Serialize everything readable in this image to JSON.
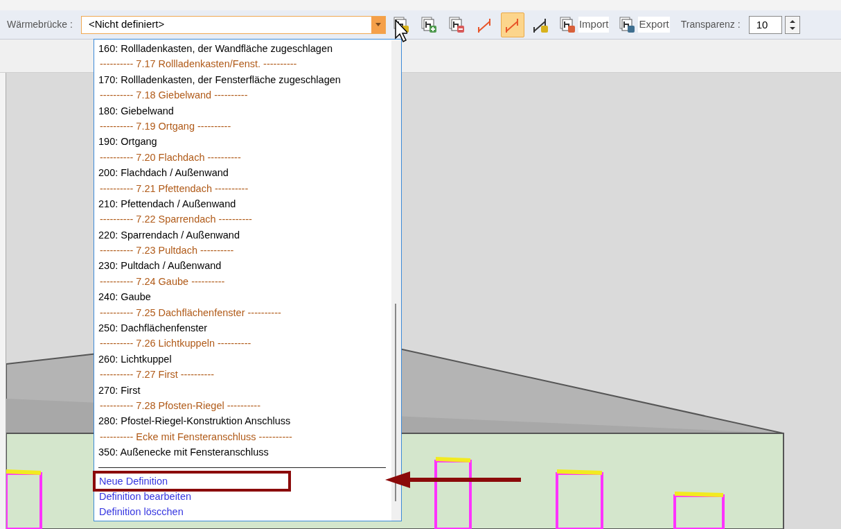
{
  "toolbar": {
    "label": "Wärmebrücke :",
    "combo_value": "<Nicht definiert>",
    "buttons": [
      {
        "kind": "edit",
        "selected": false
      },
      {
        "kind": "add",
        "selected": false
      },
      {
        "kind": "remove",
        "selected": false
      },
      {
        "kind": "line",
        "selected": false
      },
      {
        "kind": "line-active",
        "selected": true
      },
      {
        "kind": "line-edit",
        "selected": false
      },
      {
        "kind": "import",
        "label": "Import",
        "selected": false
      },
      {
        "kind": "export",
        "label": "Export",
        "selected": false
      }
    ],
    "transparency_label": "Transparenz :",
    "transparency_value": "10"
  },
  "dropdown": {
    "items": [
      {
        "kind": "entry",
        "text": "160: Rollladenkasten, der Wandfläche zugeschlagen"
      },
      {
        "kind": "header",
        "text": "---------- 7.17 Rollladenkasten/Fenst. ----------"
      },
      {
        "kind": "entry",
        "text": "170: Rollladenkasten, der Fensterfläche zugeschlagen"
      },
      {
        "kind": "header",
        "text": "---------- 7.18 Giebelwand ----------"
      },
      {
        "kind": "entry",
        "text": "180: Giebelwand"
      },
      {
        "kind": "header",
        "text": "---------- 7.19 Ortgang ----------"
      },
      {
        "kind": "entry",
        "text": "190: Ortgang"
      },
      {
        "kind": "header",
        "text": "---------- 7.20 Flachdach ----------"
      },
      {
        "kind": "entry",
        "text": "200: Flachdach / Außenwand"
      },
      {
        "kind": "header",
        "text": "---------- 7.21 Pfettendach ----------"
      },
      {
        "kind": "entry",
        "text": "210: Pfettendach / Außenwand"
      },
      {
        "kind": "header",
        "text": "---------- 7.22 Sparrendach ----------"
      },
      {
        "kind": "entry",
        "text": "220: Sparrendach / Außenwand"
      },
      {
        "kind": "header",
        "text": "---------- 7.23 Pultdach ----------"
      },
      {
        "kind": "entry",
        "text": "230: Pultdach / Außenwand"
      },
      {
        "kind": "header",
        "text": "---------- 7.24 Gaube ----------"
      },
      {
        "kind": "entry",
        "text": "240: Gaube"
      },
      {
        "kind": "header",
        "text": "---------- 7.25 Dachflächenfenster ----------"
      },
      {
        "kind": "entry",
        "text": "250: Dachflächenfenster"
      },
      {
        "kind": "header",
        "text": "---------- 7.26 Lichtkuppeln ----------"
      },
      {
        "kind": "entry",
        "text": "260: Lichtkuppel"
      },
      {
        "kind": "header",
        "text": "---------- 7.27 First ----------"
      },
      {
        "kind": "entry",
        "text": "270: First"
      },
      {
        "kind": "header",
        "text": "---------- 7.28 Pfosten-Riegel ----------"
      },
      {
        "kind": "entry",
        "text": "280: Pfostel-Riegel-Konstruktion Anschluss"
      },
      {
        "kind": "header",
        "text": "---------- Ecke mit Fensteranschluss ----------"
      },
      {
        "kind": "entry",
        "text": "350: Außenecke mit Fensteranschluss"
      }
    ],
    "actions": [
      {
        "text": "Neue Definition",
        "highlighted": true
      },
      {
        "text": "Definition bearbeiten",
        "highlighted": false
      },
      {
        "text": "Definition löscchen",
        "highlighted": false
      }
    ]
  }
}
